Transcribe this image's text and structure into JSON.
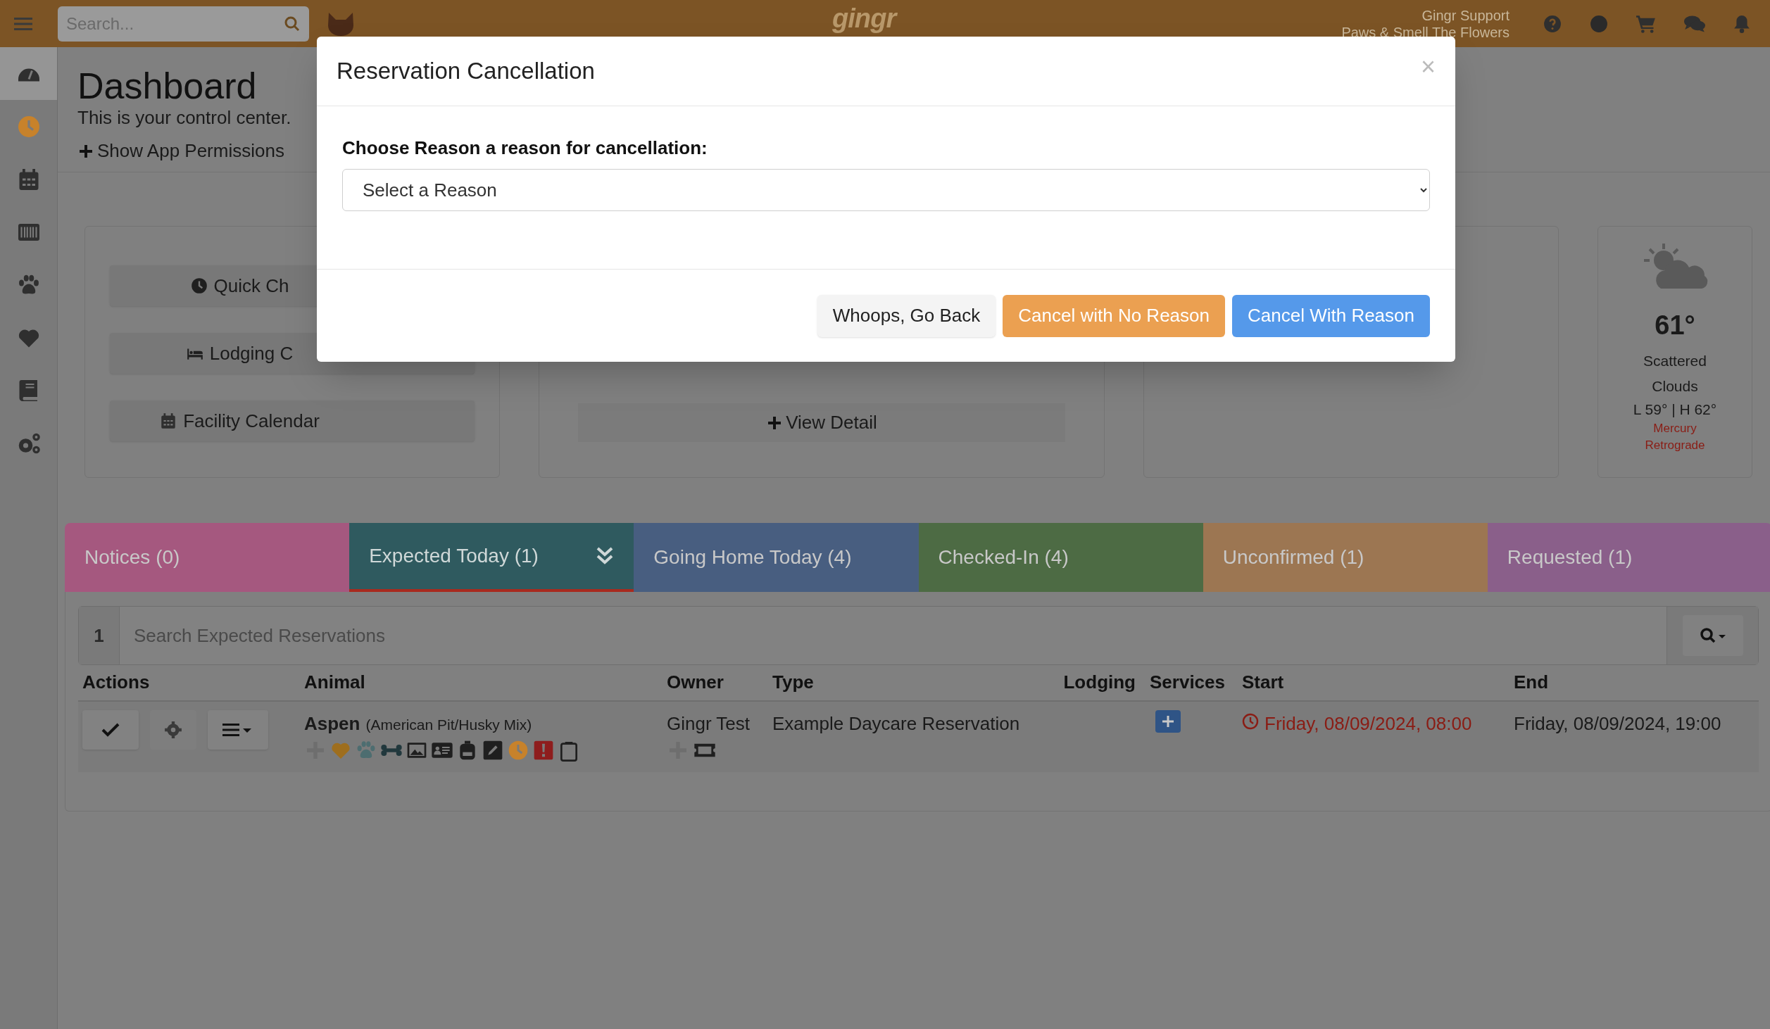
{
  "top_bar": {
    "search": {
      "placeholder": "Search..."
    },
    "logo": "gingr",
    "user_name": "Gingr Support",
    "location": "Paws & Smell The Flowers"
  },
  "sidebar": {
    "items": [
      {
        "kind": "gauge",
        "selected": true
      },
      {
        "kind": "clock",
        "selected": false
      },
      {
        "kind": "calendar",
        "selected": false
      },
      {
        "kind": "barcode",
        "selected": false
      },
      {
        "kind": "paw",
        "selected": false
      },
      {
        "kind": "heart",
        "selected": false
      },
      {
        "kind": "book",
        "selected": false
      },
      {
        "kind": "gears",
        "selected": false
      }
    ]
  },
  "header": {
    "title": "Dashboard",
    "subtitle": "This is your control center.",
    "permissions_link": "Show App Permissions"
  },
  "quick_buttons": [
    {
      "kind": "clock",
      "label": "Quick Ch"
    },
    {
      "kind": "bed",
      "label": "Lodging C"
    },
    {
      "kind": "calendar",
      "label": "Facility Calendar"
    }
  ],
  "detail_link": "View Detail",
  "weather": {
    "temperature": "61°",
    "condition": "Scattered Clouds",
    "range": "L 59° | H 62°",
    "note": "Mercury Retrograde"
  },
  "tabs": [
    {
      "label": "Notices (0)",
      "color": "#a5587f",
      "selected": false
    },
    {
      "label": "Expected Today (1)",
      "color": "#2f5a5f",
      "selected": true
    },
    {
      "label": "Going Home Today (4)",
      "color": "#485e80",
      "selected": false
    },
    {
      "label": "Checked-In (4)",
      "color": "#4d6b44",
      "selected": false
    },
    {
      "label": "Unconfirmed (1)",
      "color": "#9c7652",
      "selected": false
    },
    {
      "label": "Requested (1)",
      "color": "#8a5f8a",
      "selected": false
    }
  ],
  "table": {
    "count": "1",
    "search": {
      "placeholder": "Search Expected Reservations"
    },
    "columns": [
      "Actions",
      "Animal",
      "Owner",
      "Type",
      "Lodging",
      "Services",
      "Start",
      "End"
    ],
    "rows": [
      {
        "animal": "Aspen",
        "breed": "(American Pit/Husky Mix)",
        "animal_icons": [
          {
            "kind": "plus"
          },
          {
            "kind": "heart"
          },
          {
            "kind": "paw"
          },
          {
            "kind": "bone"
          },
          {
            "kind": "image"
          },
          {
            "kind": "id-card"
          },
          {
            "kind": "backpack"
          },
          {
            "kind": "pencil"
          },
          {
            "kind": "clock"
          },
          {
            "kind": "alert"
          },
          {
            "kind": "clipboard"
          }
        ],
        "owner": "Gingr Test",
        "owner_icons": [
          {
            "kind": "plus"
          },
          {
            "kind": "ticket"
          }
        ],
        "type": "Example Daycare Reservation",
        "start": "Friday, 08/09/2024, 08:00",
        "start_late": true,
        "end": "Friday, 08/09/2024, 19:00"
      }
    ]
  },
  "modal": {
    "title": "Reservation Cancellation",
    "close": "×",
    "label": "Choose Reason a reason for cancellation:",
    "select": {
      "placeholder": "Select a Reason"
    },
    "buttons": [
      {
        "kind": "default",
        "label": "Whoops, Go Back"
      },
      {
        "kind": "warning",
        "label": "Cancel with No Reason"
      },
      {
        "kind": "primary",
        "label": "Cancel With Reason"
      }
    ]
  }
}
